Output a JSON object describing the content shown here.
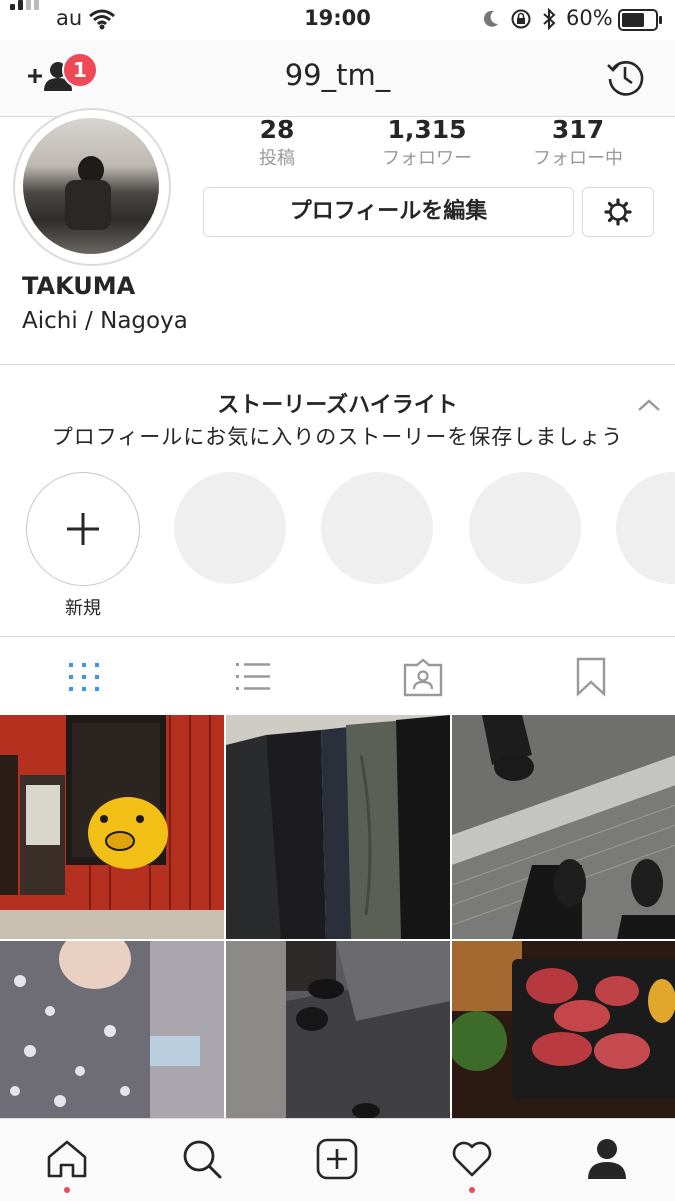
{
  "status_bar": {
    "carrier": "au",
    "time": "19:00",
    "battery": "60%"
  },
  "header": {
    "username": "99_tm_",
    "notification_count": "1"
  },
  "profile": {
    "stats": [
      {
        "value": "28",
        "label": "投稿"
      },
      {
        "value": "1,315",
        "label": "フォロワー"
      },
      {
        "value": "317",
        "label": "フォロー中"
      }
    ],
    "edit_button": "プロフィールを編集",
    "name": "TAKUMA",
    "bio": "Aichi / Nagoya"
  },
  "highlights": {
    "title": "ストーリーズハイライト",
    "subtitle": "プロフィールにお気に入りのストーリーを保存しましょう",
    "new_label": "新規"
  },
  "tabs": [
    "grid-icon",
    "list-icon",
    "tagged-icon",
    "saved-icon"
  ],
  "posts": [
    "red-storefront-photo",
    "hanging-jackets-photo",
    "sneakers-escalator-photo",
    "person-shirt-photo",
    "shoes-floor-photo",
    "yakiniku-meat-photo"
  ],
  "colors": {
    "accent": "#3897f0",
    "badge": "#ed4956",
    "text": "#262626",
    "muted": "#999999"
  }
}
